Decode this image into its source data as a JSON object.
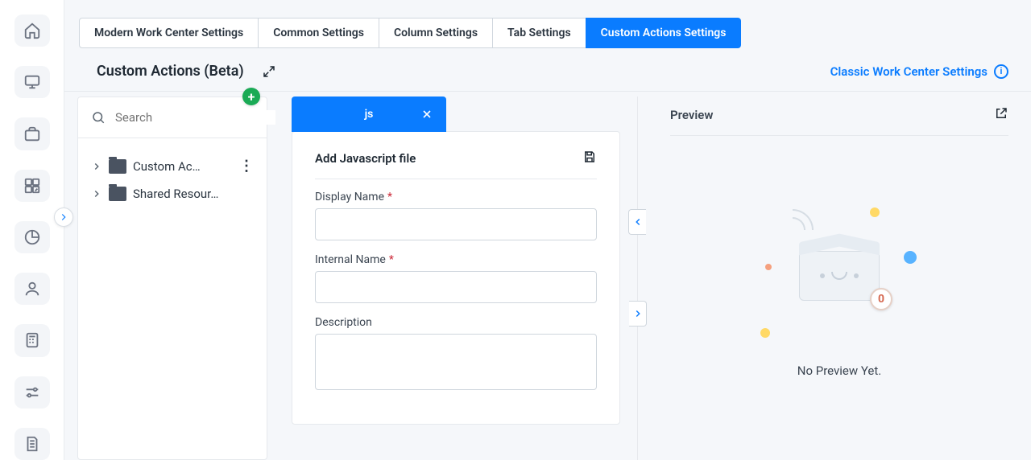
{
  "rail": {
    "items": [
      "home",
      "monitor",
      "briefcase",
      "grid",
      "pie",
      "user",
      "calc",
      "sliders",
      "file"
    ]
  },
  "tabs": {
    "items": [
      {
        "label": "Modern Work Center Settings",
        "active": false
      },
      {
        "label": "Common Settings",
        "active": false
      },
      {
        "label": "Column Settings",
        "active": false
      },
      {
        "label": "Tab Settings",
        "active": false
      },
      {
        "label": "Custom Actions Settings",
        "active": true
      }
    ]
  },
  "header": {
    "title": "Custom Actions (Beta)",
    "classic_link": "Classic Work Center Settings"
  },
  "tree": {
    "search_placeholder": "Search",
    "items": [
      {
        "label": "Custom Ac…",
        "has_menu": true
      },
      {
        "label": "Shared Resour…",
        "has_menu": false
      }
    ]
  },
  "form": {
    "tab_label": "js",
    "title": "Add Javascript file",
    "fields": {
      "display_name": {
        "label": "Display Name",
        "required": true,
        "value": ""
      },
      "internal_name": {
        "label": "Internal Name",
        "required": true,
        "value": ""
      },
      "description": {
        "label": "Description",
        "required": false,
        "value": ""
      }
    }
  },
  "preview": {
    "title": "Preview",
    "empty_text": "No Preview Yet.",
    "badge": "0"
  }
}
